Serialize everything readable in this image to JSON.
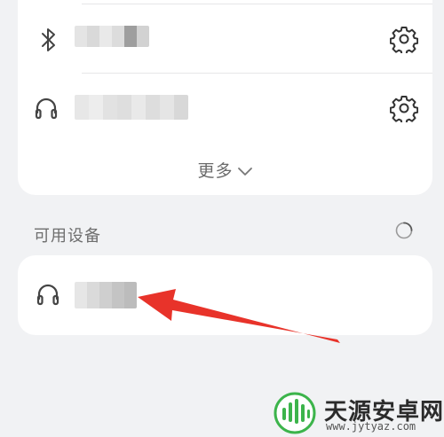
{
  "paired_devices": [
    {
      "type": "bluetooth",
      "icon": "bluetooth-icon",
      "name_obscured": true,
      "settings_icon": "gear-icon"
    },
    {
      "type": "headset",
      "icon": "headphones-icon",
      "name_obscured": true,
      "settings_icon": "gear-icon"
    }
  ],
  "more_label": "更多",
  "available_section": {
    "label": "可用设备",
    "scanning_icon": "loading-spinner-icon",
    "devices": [
      {
        "type": "headset",
        "icon": "headphones-icon",
        "name_obscured": true
      }
    ]
  },
  "annotation": {
    "color": "#e8332a"
  },
  "watermark": {
    "text": "天源安卓网",
    "url": "www.jytyaz.com",
    "logo_color": "#3cb44b"
  }
}
